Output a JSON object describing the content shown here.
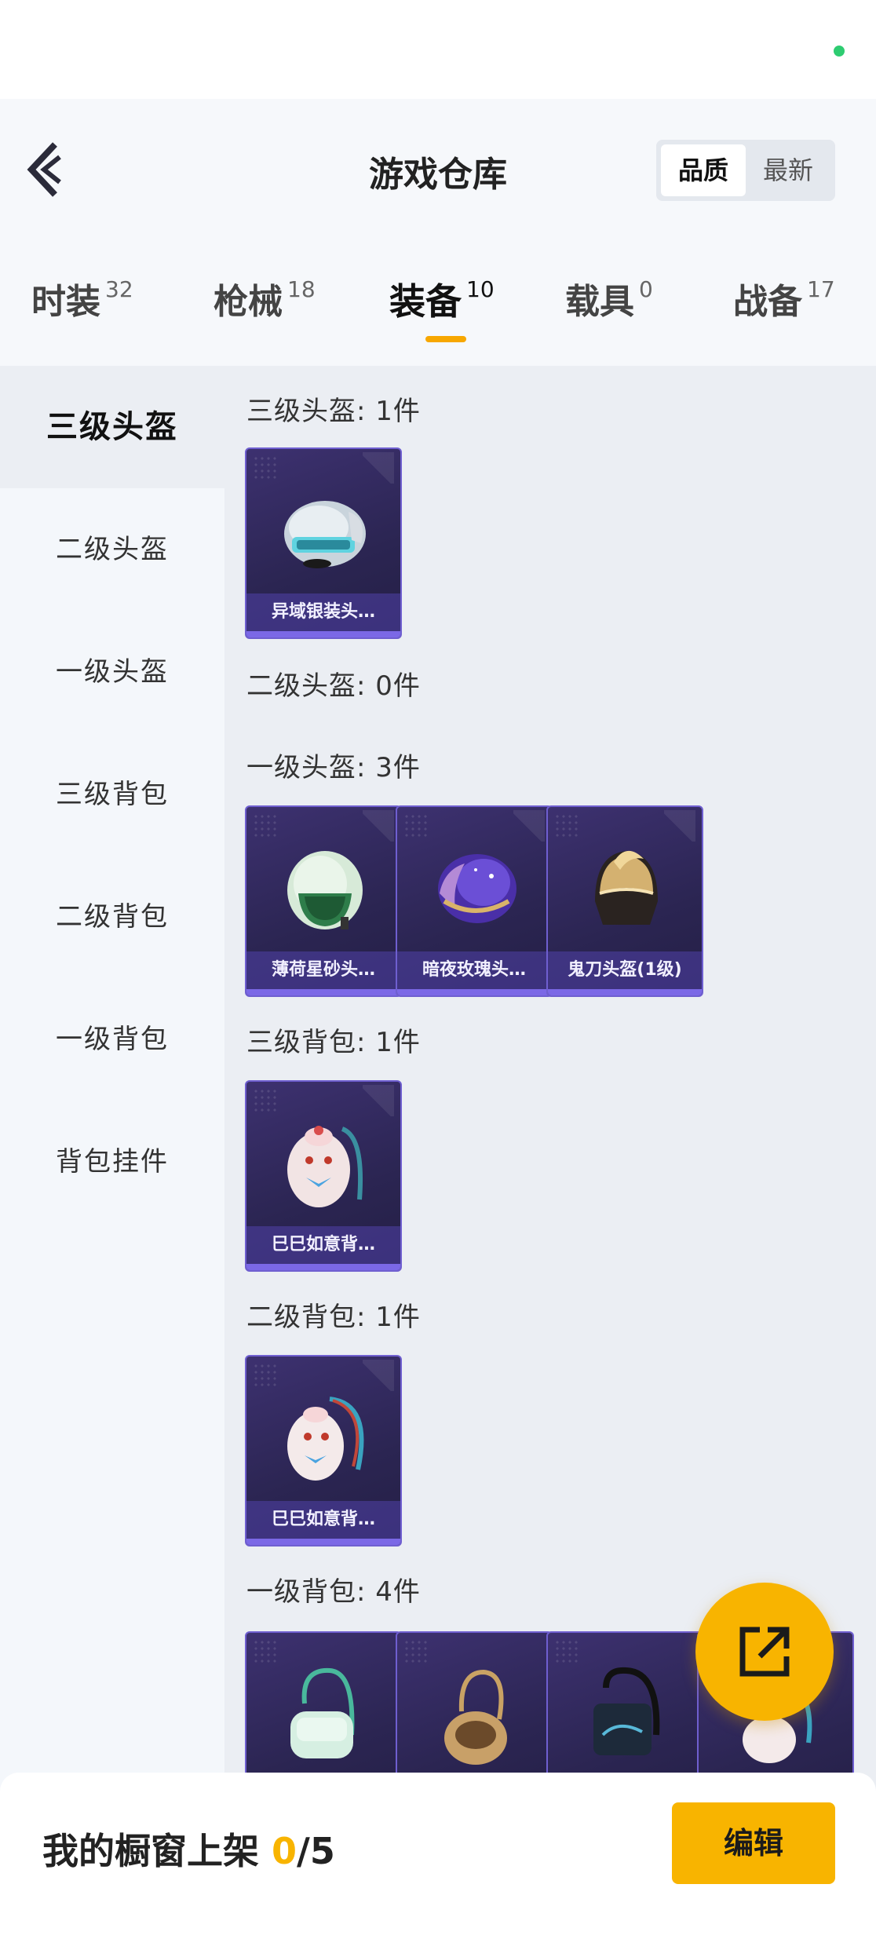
{
  "header": {
    "title": "游戏仓库",
    "sort": {
      "active": "品质",
      "inactive": "最新"
    }
  },
  "tabs": [
    {
      "label": "时装",
      "count": "32"
    },
    {
      "label": "枪械",
      "count": "18"
    },
    {
      "label": "装备",
      "count": "10"
    },
    {
      "label": "载具",
      "count": "0"
    },
    {
      "label": "战备",
      "count": "17"
    }
  ],
  "sidebar": [
    "三级头盔",
    "二级头盔",
    "一级头盔",
    "三级背包",
    "二级背包",
    "一级背包",
    "背包挂件"
  ],
  "sections": [
    {
      "title": "三级头盔: 1件",
      "items": [
        "异域银装头…"
      ]
    },
    {
      "title": "二级头盔: 0件",
      "items": []
    },
    {
      "title": "一级头盔: 3件",
      "items": [
        "薄荷星砂头…",
        "暗夜玫瑰头…",
        "鬼刀头盔(1级)"
      ]
    },
    {
      "title": "三级背包: 1件",
      "items": [
        "巳巳如意背…"
      ]
    },
    {
      "title": "二级背包: 1件",
      "items": [
        "巳巳如意背…"
      ]
    },
    {
      "title": "一级背包: 4件",
      "items": [
        "",
        "",
        "",
        ""
      ]
    }
  ],
  "bottom": {
    "label": "我的橱窗上架 ",
    "current": "0",
    "total": "/5",
    "edit": "编辑"
  },
  "icons": {
    "back": "back-chevron-icon",
    "share": "share-external-icon"
  },
  "colors": {
    "accent": "#f8b400",
    "card_border": "#6f5fd0"
  }
}
